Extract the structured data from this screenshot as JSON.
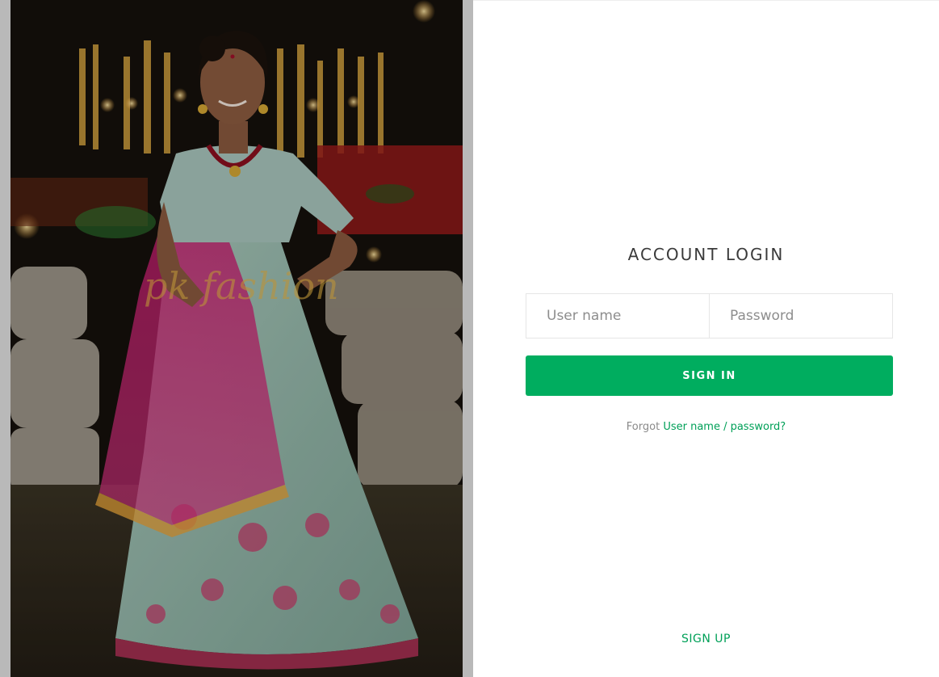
{
  "login": {
    "title": "ACCOUNT LOGIN",
    "username_placeholder": "User name",
    "password_placeholder": "Password",
    "signin_label": "SIGN IN",
    "forgot_prefix": "Forgot",
    "forgot_link": "User name / password?",
    "signup_label": "SIGN UP"
  },
  "photo": {
    "watermark": "pk fashion"
  },
  "colors": {
    "accent": "#00ad5f",
    "link": "#00a058",
    "title": "#3a3a3a"
  }
}
